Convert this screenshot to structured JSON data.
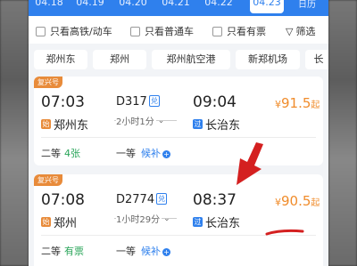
{
  "dates": [
    "04.18",
    "04.19",
    "04.20",
    "04.21",
    "04.22",
    "04.23"
  ],
  "dates_extra": "日历",
  "filters": {
    "high_speed_only": "只看高铁/动车",
    "normal_only": "只看普通车",
    "available_only": "只看有票",
    "filter_label": "筛选"
  },
  "stations": [
    "郑州东",
    "郑州",
    "郑州航空港",
    "新郑机场",
    "长"
  ],
  "trains": [
    {
      "tag": "复兴号",
      "dep_time": "07:03",
      "train_no": "D317",
      "badge": "兑",
      "duration": "2小时1分",
      "arr_time": "09:04",
      "from_icon": "始",
      "from_station": "郑州东",
      "to_icon": "过",
      "to_station": "长治东",
      "price_currency": "¥",
      "price": "91.5",
      "price_suffix": "起",
      "seat1_label": "二等",
      "seat1_value": "4张",
      "seat2_label": "一等",
      "seat2_action": "候补"
    },
    {
      "tag": "复兴号",
      "dep_time": "07:08",
      "train_no": "D2774",
      "badge": "兑",
      "duration": "1小时29分",
      "arr_time": "08:37",
      "from_icon": "始",
      "from_station": "郑州",
      "to_icon": "过",
      "to_station": "长治东",
      "price_currency": "¥",
      "price": "90.5",
      "price_suffix": "起",
      "seat1_label": "二等",
      "seat1_value": "有票",
      "seat2_label": "一等",
      "seat2_action": "候补"
    }
  ],
  "colors": {
    "accent": "#2f80ed",
    "price": "#f08c2b",
    "available": "#2aa55a",
    "annotation": "#d42020"
  }
}
